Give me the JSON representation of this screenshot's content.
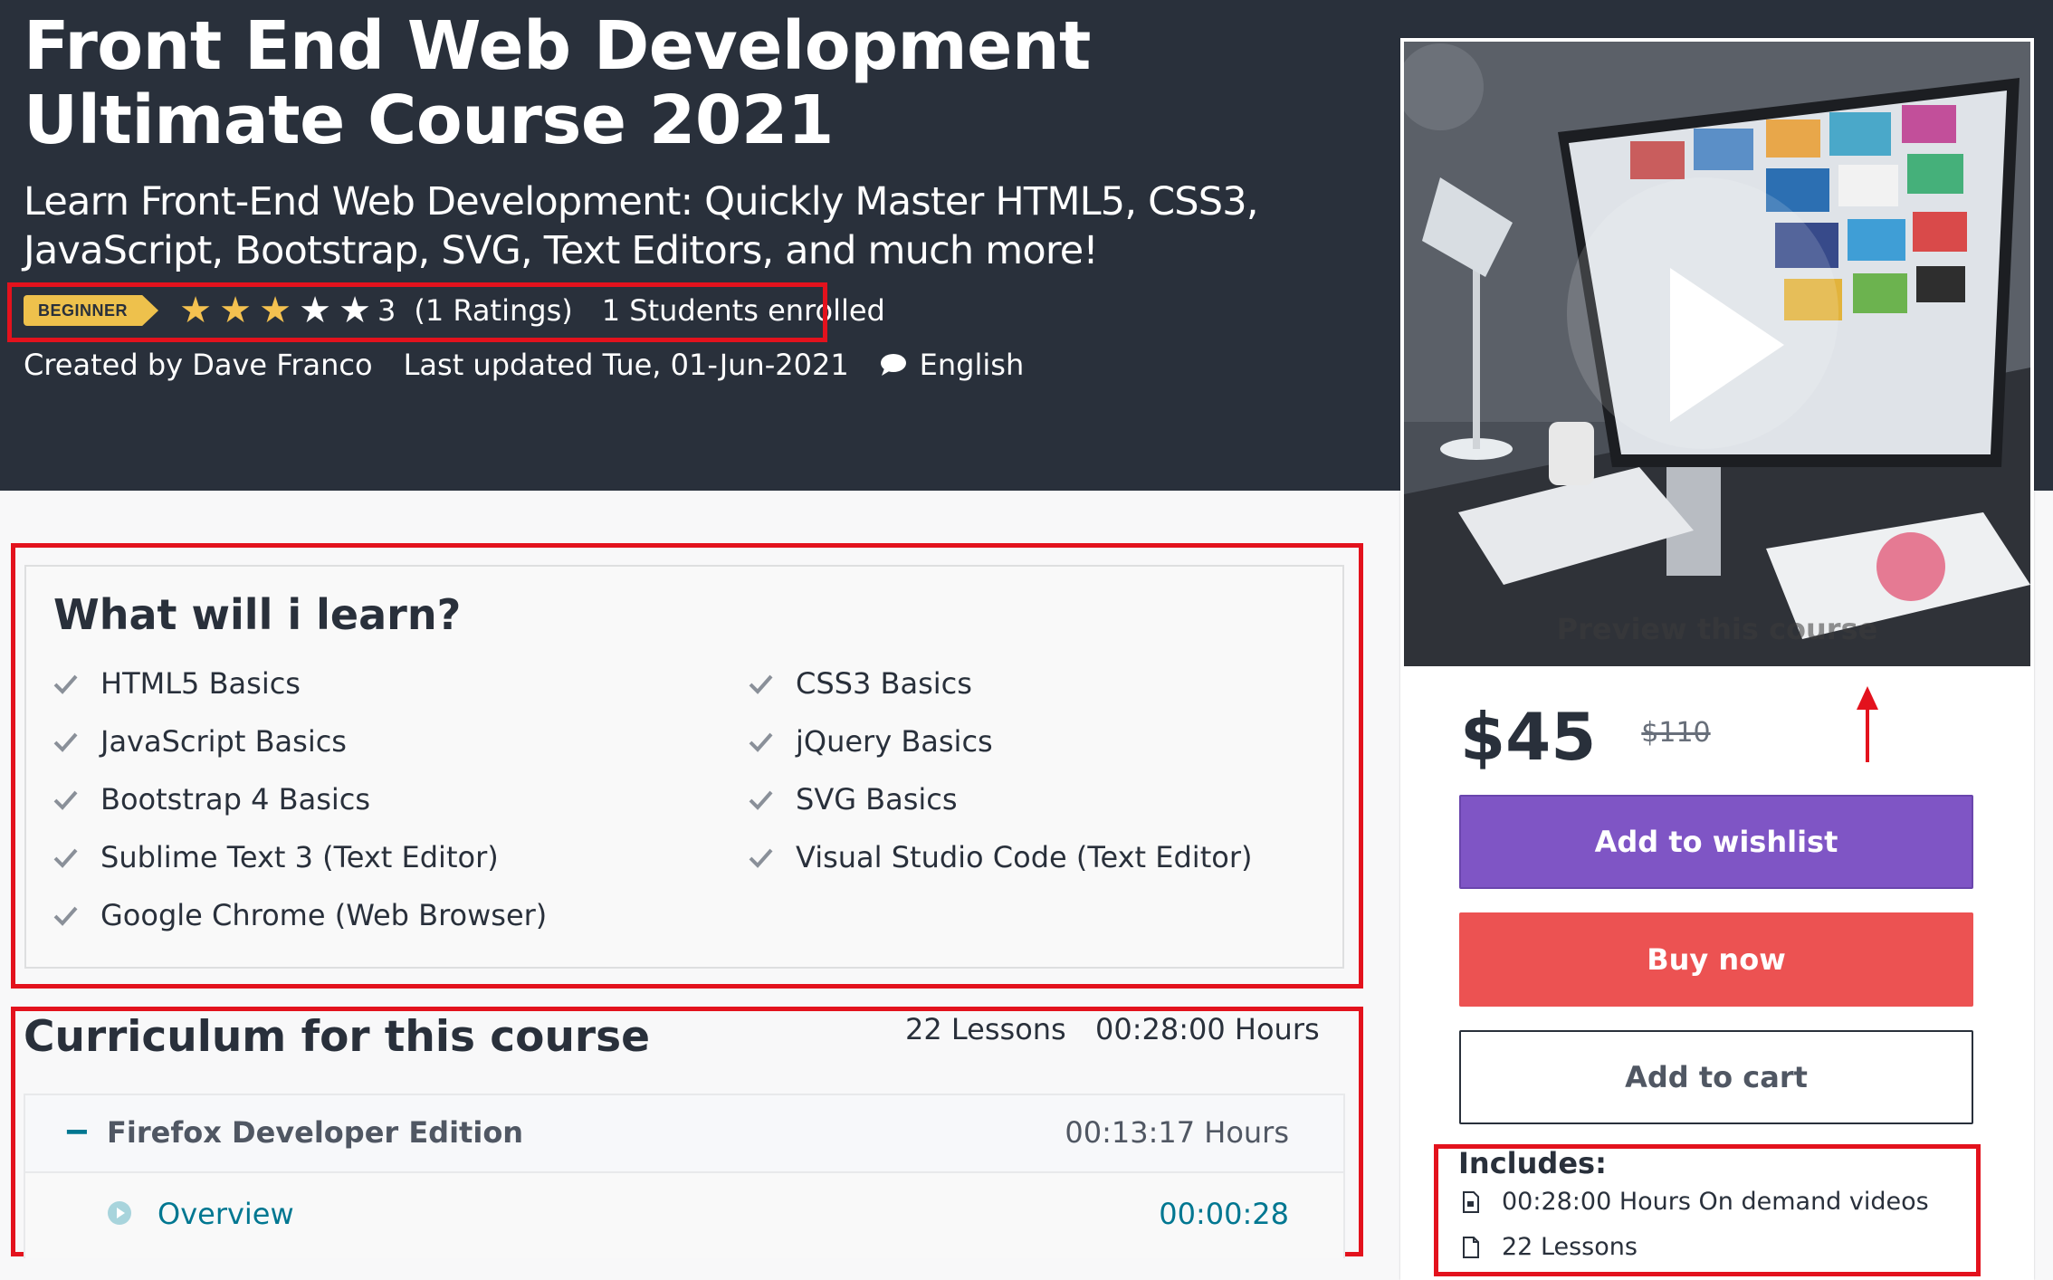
{
  "course": {
    "title": "Front End Web Development Ultimate Course 2021",
    "subtitle": "Learn Front-End Web Development: Quickly Master HTML5, CSS3, JavaScript, Bootstrap, SVG, Text Editors, and much more!",
    "level": "BEGINNER",
    "rating_value": "3",
    "rating_stars": 3,
    "rating_max": 5,
    "ratings_count": "(1 Ratings)",
    "students": "1 Students enrolled",
    "created_by": "Created by Dave Franco",
    "last_updated": "Last updated Tue, 01-Jun-2021",
    "language": "English"
  },
  "learn": {
    "heading": "What will i learn?",
    "items": [
      "HTML5 Basics",
      "CSS3 Basics",
      "JavaScript Basics",
      "jQuery Basics",
      "Bootstrap 4 Basics",
      "SVG Basics",
      "Sublime Text 3 (Text Editor)",
      "Visual Studio Code (Text Editor)",
      "Google Chrome (Web Browser)"
    ]
  },
  "curriculum": {
    "title": "Curriculum for this course",
    "lessons": "22 Lessons",
    "hours": "00:28:00 Hours",
    "sections": [
      {
        "toggle": "−",
        "title": "Firefox Developer Edition",
        "duration": "00:13:17 Hours",
        "lessons": [
          {
            "title": "Overview",
            "duration": "00:00:28"
          }
        ]
      }
    ]
  },
  "sidebar": {
    "preview_caption": "Preview this course",
    "price": "$45",
    "original_price": "$110",
    "wishlist_label": "Add to wishlist",
    "buy_label": "Buy now",
    "cart_label": "Add to cart",
    "includes_title": "Includes:",
    "includes": [
      "00:28:00 Hours On demand videos",
      "22 Lessons"
    ]
  },
  "colors": {
    "header_bg": "#29303b",
    "badge": "#eec14c",
    "star": "#f4c150",
    "wishlist": "#7f55c5",
    "buy": "#ec5252",
    "link": "#007791",
    "annotation": "#e3121d"
  },
  "icons": {
    "language": "speech-bubble-icon",
    "check": "check-icon",
    "play": "play-circle-icon",
    "video": "video-file-icon",
    "lessons": "file-icon",
    "arrow": "arrow-up-icon"
  }
}
